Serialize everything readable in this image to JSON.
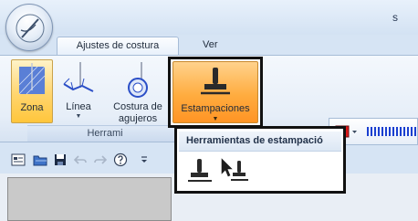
{
  "window": {
    "title": "s"
  },
  "tabs": [
    {
      "label": "Ajustes de costura"
    },
    {
      "label": "Ver"
    }
  ],
  "ribbon": {
    "buttons": [
      {
        "label": "Zona",
        "icon": "area-fill-icon"
      },
      {
        "label": "Línea",
        "icon": "line-stitch-icon"
      },
      {
        "label": "Costura de",
        "label2": "agujeros",
        "icon": "eyelet-stitch-icon"
      },
      {
        "label": "Estampaciones",
        "icon": "stamp-icon"
      }
    ],
    "group_label": "Herrami"
  },
  "popup": {
    "title": "Herramientas de estampació",
    "tools": [
      {
        "icon": "stamp-tool-icon"
      },
      {
        "icon": "select-stamp-icon"
      }
    ]
  },
  "colors": {
    "accent_orange": "#ffac3f",
    "selected_yellow": "#ffd56e",
    "thread_red": "#e01818",
    "thread_blue": "#1a3fd0"
  }
}
